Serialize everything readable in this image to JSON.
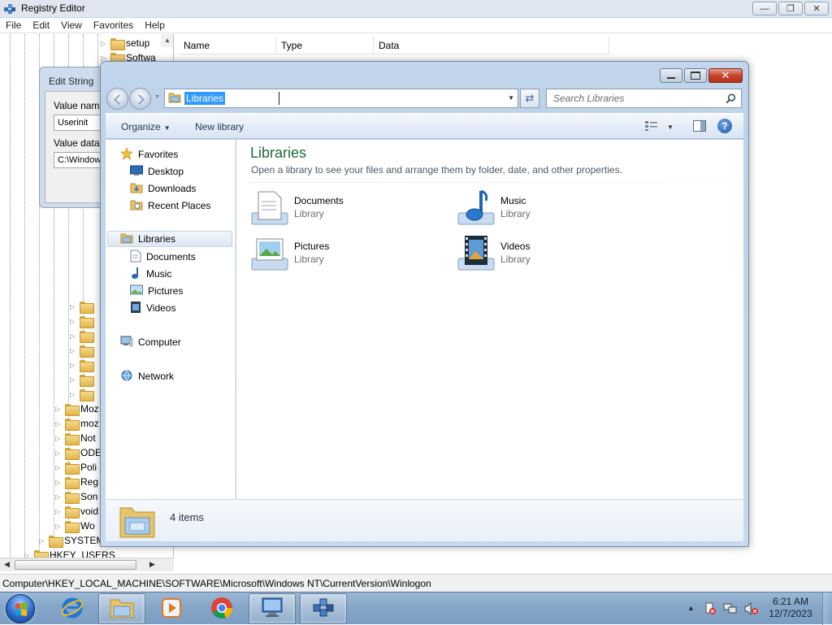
{
  "registry": {
    "title": "Registry Editor",
    "menu": [
      "File",
      "Edit",
      "View",
      "Favorites",
      "Help"
    ],
    "tree_top": [
      "setup",
      "Softwa"
    ],
    "tree_bottom": [
      "Moz",
      "moz",
      "Not",
      "ODE",
      "Poli",
      "Reg",
      "Son",
      "void",
      "Wo"
    ],
    "tree_system": "SYSTEM",
    "tree_users": "HKEY_USERS",
    "columns": [
      "Name",
      "Type",
      "Data"
    ],
    "status_path": "Computer\\HKEY_LOCAL_MACHINE\\SOFTWARE\\Microsoft\\Windows NT\\CurrentVersion\\Winlogon"
  },
  "edit_string": {
    "title": "Edit String",
    "value_name_label": "Value name",
    "value_name": "Userinit",
    "value_data_label": "Value data:",
    "value_data": "C:\\Window"
  },
  "explorer": {
    "address": "Libraries",
    "search_placeholder": "Search Libraries",
    "commands": {
      "organize": "Organize",
      "new_library": "New library"
    },
    "nav": {
      "favorites": "Favorites",
      "favorites_items": [
        "Desktop",
        "Downloads",
        "Recent Places"
      ],
      "libraries": "Libraries",
      "libraries_items": [
        "Documents",
        "Music",
        "Pictures",
        "Videos"
      ],
      "computer": "Computer",
      "network": "Network"
    },
    "heading": "Libraries",
    "description": "Open a library to see your files and arrange them by folder, date, and other properties.",
    "items": [
      {
        "name": "Documents",
        "type": "Library",
        "icon": "documents-library-icon"
      },
      {
        "name": "Music",
        "type": "Library",
        "icon": "music-library-icon"
      },
      {
        "name": "Pictures",
        "type": "Library",
        "icon": "pictures-library-icon"
      },
      {
        "name": "Videos",
        "type": "Library",
        "icon": "videos-library-icon"
      }
    ],
    "item_count": "4 items"
  },
  "taskbar": {
    "pinned": [
      "internet-explorer-icon",
      "windows-explorer-icon",
      "media-player-icon",
      "chrome-icon",
      "remote-desktop-icon",
      "registry-editor-icon"
    ],
    "time": "6:21 AM",
    "date": "12/7/2023"
  },
  "colors": {
    "accent": "#3399ff",
    "library_heading": "#1e6b38",
    "close_red": "#c6452d"
  }
}
